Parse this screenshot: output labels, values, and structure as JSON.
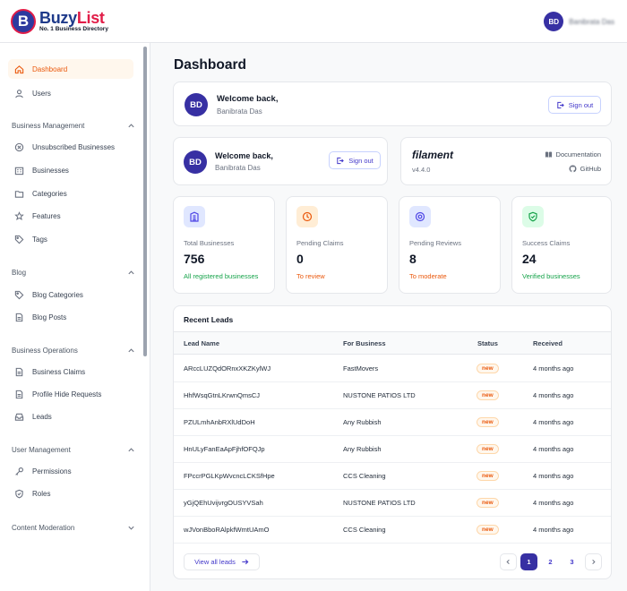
{
  "brand": {
    "name_part1": "Buzy",
    "name_part2": "List",
    "tagline": "No. 1 Business Directory",
    "logo_letter": "B"
  },
  "user": {
    "initials": "BD",
    "name": "Banibrata Das"
  },
  "sidebar": {
    "top_items": [
      {
        "label": "Dashboard",
        "icon": "home-icon",
        "active": true
      },
      {
        "label": "Users",
        "icon": "user-icon",
        "active": false
      }
    ],
    "groups": [
      {
        "label": "Business Management",
        "expanded": true,
        "items": [
          {
            "label": "Unsubscribed Businesses",
            "icon": "x-circle-icon"
          },
          {
            "label": "Businesses",
            "icon": "building-icon"
          },
          {
            "label": "Categories",
            "icon": "folder-icon"
          },
          {
            "label": "Features",
            "icon": "star-icon"
          },
          {
            "label": "Tags",
            "icon": "tag-icon"
          }
        ]
      },
      {
        "label": "Blog",
        "expanded": true,
        "items": [
          {
            "label": "Blog Categories",
            "icon": "tag-icon"
          },
          {
            "label": "Blog Posts",
            "icon": "document-icon"
          }
        ]
      },
      {
        "label": "Business Operations",
        "expanded": true,
        "items": [
          {
            "label": "Business Claims",
            "icon": "document-icon"
          },
          {
            "label": "Profile Hide Requests",
            "icon": "document-icon"
          },
          {
            "label": "Leads",
            "icon": "inbox-icon"
          }
        ]
      },
      {
        "label": "User Management",
        "expanded": true,
        "items": [
          {
            "label": "Permissions",
            "icon": "key-icon"
          },
          {
            "label": "Roles",
            "icon": "shield-icon"
          }
        ]
      },
      {
        "label": "Content Moderation",
        "expanded": false,
        "items": []
      }
    ]
  },
  "main": {
    "page_title": "Dashboard",
    "welcome": {
      "title": "Welcome back,",
      "name": "Banibrata Das",
      "sign_out": "Sign out"
    },
    "filament": {
      "name": "filament",
      "version": "v4.4.0",
      "docs": "Documentation",
      "github": "GitHub"
    },
    "stats": [
      {
        "label": "Total Businesses",
        "value": "756",
        "note": "All registered businesses",
        "color": "#16a34a",
        "bg": "#e0e7ff",
        "icon": "building-icon",
        "icon_color": "#4f46e5"
      },
      {
        "label": "Pending Claims",
        "value": "0",
        "note": "To review",
        "color": "#ea580c",
        "bg": "#ffedd5",
        "icon": "clock-icon",
        "icon_color": "#ea580c"
      },
      {
        "label": "Pending Reviews",
        "value": "8",
        "note": "To moderate",
        "color": "#ea580c",
        "bg": "#e0e7ff",
        "icon": "eye-target-icon",
        "icon_color": "#4f46e5"
      },
      {
        "label": "Success Claims",
        "value": "24",
        "note": "Verified businesses",
        "color": "#16a34a",
        "bg": "#dcfce7",
        "icon": "shield-check-icon",
        "icon_color": "#16a34a"
      }
    ],
    "leads": {
      "title": "Recent Leads",
      "columns": [
        "Lead Name",
        "For Business",
        "Status",
        "Received"
      ],
      "rows": [
        {
          "name": "ARccLUZQdORnxXKZKylWJ",
          "business": "FastMovers",
          "status": "new",
          "received": "4 months ago"
        },
        {
          "name": "HhfWsqGtnLKrwnQmsCJ",
          "business": "NUSTONE PATIOS LTD",
          "status": "new",
          "received": "4 months ago"
        },
        {
          "name": "PZULmhAnbRXlUdDoH",
          "business": "Any Rubbish",
          "status": "new",
          "received": "4 months ago"
        },
        {
          "name": "HnULyFanEaApFjhfOFQJp",
          "business": "Any Rubbish",
          "status": "new",
          "received": "4 months ago"
        },
        {
          "name": "FPccrPGLKpWvcncLCKSfHpe",
          "business": "CCS Cleaning",
          "status": "new",
          "received": "4 months ago"
        },
        {
          "name": "yGjQEhUvijvrgOUSYVSah",
          "business": "NUSTONE PATIOS LTD",
          "status": "new",
          "received": "4 months ago"
        },
        {
          "name": "wJVonBboRAlpkfWmtUAmO",
          "business": "CCS Cleaning",
          "status": "new",
          "received": "4 months ago"
        }
      ],
      "view_all": "View all leads",
      "pages": [
        "1",
        "2",
        "3"
      ],
      "current_page": "1"
    }
  }
}
